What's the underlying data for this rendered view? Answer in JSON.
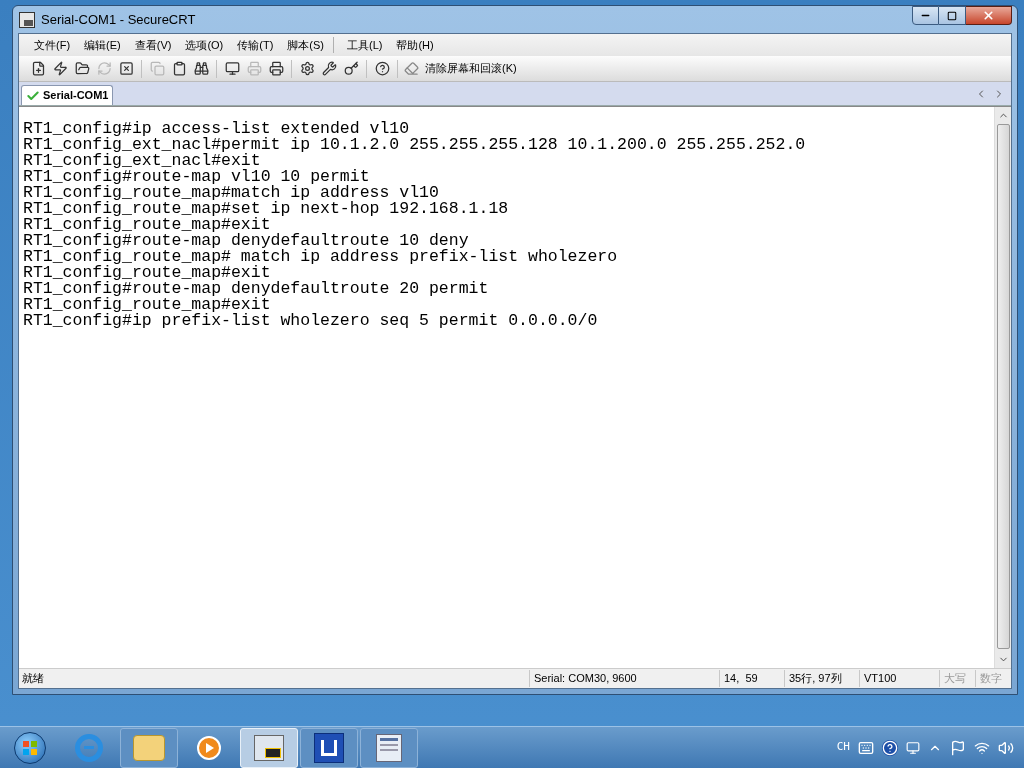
{
  "window": {
    "title": "Serial-COM1 - SecureCRT"
  },
  "menu": [
    "文件(F)",
    "编辑(E)",
    "查看(V)",
    "选项(O)",
    "传输(T)",
    "脚本(S)",
    "工具(L)",
    "帮助(H)"
  ],
  "toolbar": {
    "groups": [
      [
        {
          "disabled": false
        },
        {
          "disabled": false
        },
        {
          "disabled": false
        },
        {
          "disabled": true
        },
        {
          "disabled": false
        }
      ],
      [
        {
          "disabled": true
        },
        {
          "disabled": false
        },
        {
          "disabled": false
        }
      ],
      [
        {
          "disabled": false
        },
        {
          "disabled": true
        },
        {
          "disabled": false
        }
      ],
      [
        {
          "disabled": false
        },
        {
          "disabled": false
        },
        {
          "disabled": false
        }
      ],
      [
        {
          "disabled": false
        }
      ]
    ],
    "clear_button": {
      "label": "清除屏幕和回滚(K)"
    }
  },
  "tabs": [
    {
      "label": "Serial-COM1",
      "selected": true,
      "connected": true
    }
  ],
  "terminal": {
    "lines": [
      "RT1_config#ip access-list extended vl10",
      "RT1_config_ext_nacl#permit ip 10.1.2.0 255.255.255.128 10.1.200.0 255.255.252.0",
      "RT1_config_ext_nacl#exit",
      "RT1_config#route-map vl10 10 permit",
      "RT1_config_route_map#match ip address vl10",
      "RT1_config_route_map#set ip next-hop 192.168.1.18",
      "RT1_config_route_map#exit",
      "RT1_config#route-map denydefaultroute 10 deny",
      "RT1_config_route_map# match ip address prefix-list wholezero",
      "RT1_config_route_map#exit",
      "RT1_config#route-map denydefaultroute 20 permit",
      "RT1_config_route_map#exit",
      "RT1_config#ip prefix-list wholezero seq 5 permit 0.0.0.0/0"
    ]
  },
  "status_bar": {
    "message": "就绪",
    "items": [
      {
        "text": "Serial: COM30, 9600",
        "disabled": false
      },
      {
        "text": "14,  59",
        "disabled": false
      },
      {
        "text": "35行, 97列",
        "disabled": false
      },
      {
        "text": "VT100",
        "disabled": false
      },
      {
        "text": "大写",
        "disabled": true
      },
      {
        "text": "数字",
        "disabled": true
      }
    ]
  },
  "taskbar": {
    "apps": [
      {
        "selected": false
      },
      {
        "selected": false
      },
      {
        "selected": false
      },
      {
        "selected": false
      },
      {
        "selected": true
      },
      {
        "selected": false
      },
      {
        "selected": false
      }
    ],
    "tray": {
      "language": "CH"
    }
  }
}
